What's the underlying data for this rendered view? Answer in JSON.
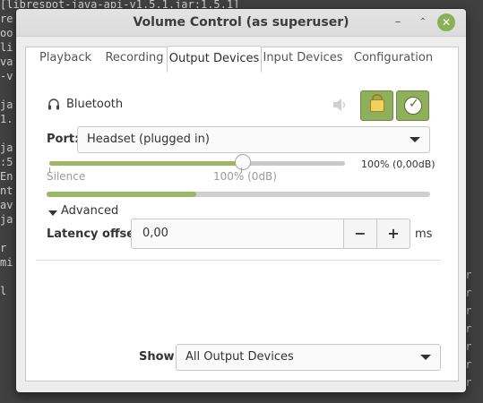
{
  "terminal": {
    "top_line": "[librespot-java-api-v1.5.1.jar:1.5.1]",
    "left_lines": [
      "re",
      "oo",
      "li",
      "va",
      "-v",
      "",
      "ja",
      "1.",
      "",
      "ja",
      ":5",
      "En",
      "nt",
      "av",
      "ja",
      "",
      "r",
      "mi",
      "",
      "l"
    ],
    "right_lines": [
      "or",
      "or",
      "or",
      "or",
      "or",
      "or",
      "or"
    ]
  },
  "window": {
    "title": "Volume Control (as superuser)",
    "controls": {
      "minimize": "–",
      "maximize": "⌃",
      "close": "✕"
    }
  },
  "tabs": [
    {
      "label": "Playback",
      "active": false
    },
    {
      "label": "Recording",
      "active": false
    },
    {
      "label": "Output Devices",
      "active": true
    },
    {
      "label": "Input Devices",
      "active": false
    },
    {
      "label": "Configuration",
      "active": false
    }
  ],
  "device": {
    "name": "Bluetooth",
    "icon": "headset-icon",
    "port_label": "Port:",
    "port_value": "Headset (plugged in)",
    "volume_fraction": 0.65,
    "volume_readout": "100% (0,00dB)",
    "label_silence": "Silence",
    "label_100": "100% (0dB)",
    "level_fraction": 0.39,
    "advanced_label": "Advanced",
    "latency_label": "Latency offset:",
    "latency_value": "0,00",
    "minus_label": "−",
    "plus_label": "+",
    "latency_unit": "ms"
  },
  "footer": {
    "show_label": "Show:",
    "show_value": "All Output Devices"
  },
  "colors": {
    "accent": "#8fb05a",
    "slider_fill": "#9bb667"
  }
}
